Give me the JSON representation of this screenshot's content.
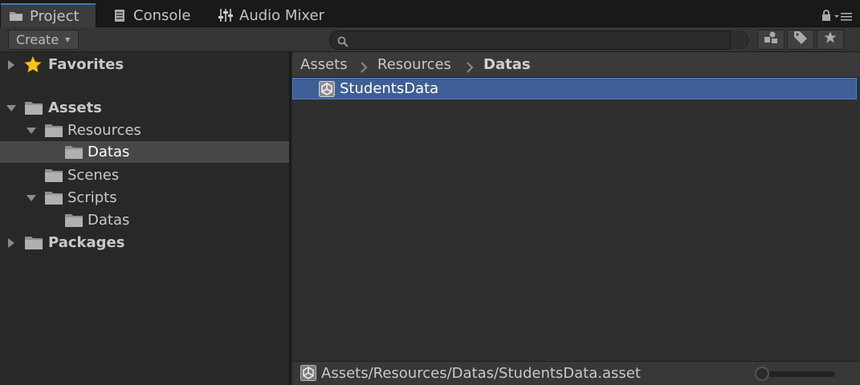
{
  "tabs": [
    {
      "label": "Project",
      "icon": "folder-icon",
      "active": true
    },
    {
      "label": "Console",
      "icon": "console-icon",
      "active": false
    },
    {
      "label": "Audio Mixer",
      "icon": "mixer-icon",
      "active": false
    }
  ],
  "toolbar": {
    "create_label": "Create",
    "search_value": "",
    "buttons": [
      "filter-by-type-icon",
      "filter-by-label-icon",
      "favorite-star-icon"
    ]
  },
  "tree": {
    "favorites": "Favorites",
    "assets": "Assets",
    "resources": "Resources",
    "resources_datas": "Datas",
    "scenes": "Scenes",
    "scripts": "Scripts",
    "scripts_datas": "Datas",
    "packages": "Packages"
  },
  "breadcrumb": [
    "Assets",
    "Resources",
    "Datas"
  ],
  "assets_list": [
    {
      "label": "StudentsData",
      "icon": "unity-asset-icon",
      "selected": true
    }
  ],
  "status": {
    "path": "Assets/Resources/Datas/StudentsData.asset",
    "zoom": 0
  },
  "colors": {
    "selection": "#3e5f96",
    "tab_accent": "#3a79bb",
    "background": "#282828"
  }
}
